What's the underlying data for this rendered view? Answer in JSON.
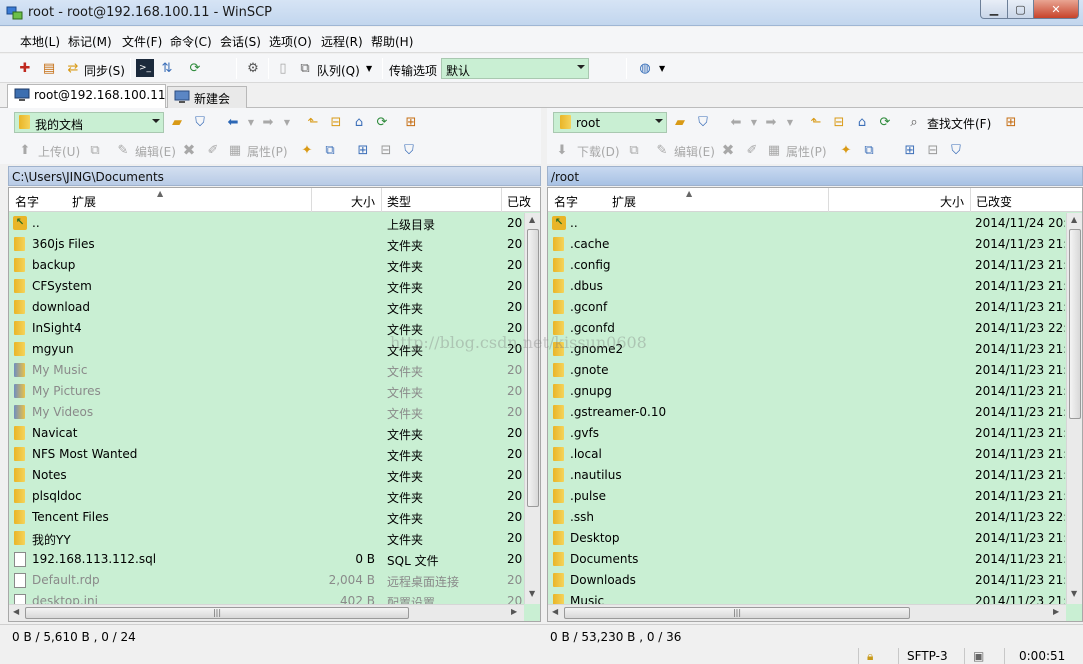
{
  "window": {
    "title": "root - root@192.168.100.11 - WinSCP",
    "min_label": "▁",
    "max_label": "▢",
    "close_label": "✕"
  },
  "menu": [
    "本地(L)",
    "标记(M)",
    "文件(F)",
    "命令(C)",
    "会话(S)",
    "选项(O)",
    "远程(R)",
    "帮助(H)"
  ],
  "toolbar": {
    "sync_label": "同步(S)",
    "queue_label": "队列(Q)",
    "transfer_label": "传输选项",
    "transfer_value": "默认"
  },
  "tabs": {
    "session": "root@192.168.100.11",
    "new_session": "新建会话"
  },
  "left": {
    "location": "我的文档",
    "upload": "上传(U)",
    "edit": "编辑(E)",
    "properties": "属性(P)",
    "path": "C:\\Users\\JING\\Documents",
    "columns": {
      "name": "名字",
      "ext": "扩展",
      "size": "大小",
      "type": "类型",
      "changed": "已改"
    },
    "rows": [
      {
        "name": "..",
        "size": "",
        "type": "上级目录",
        "changed": "20",
        "kind": "up",
        "gray": false
      },
      {
        "name": "360js Files",
        "size": "",
        "type": "文件夹",
        "changed": "20",
        "kind": "folder",
        "gray": false
      },
      {
        "name": "backup",
        "size": "",
        "type": "文件夹",
        "changed": "20",
        "kind": "folder",
        "gray": false
      },
      {
        "name": "CFSystem",
        "size": "",
        "type": "文件夹",
        "changed": "20",
        "kind": "folder",
        "gray": false
      },
      {
        "name": "download",
        "size": "",
        "type": "文件夹",
        "changed": "20",
        "kind": "folder",
        "gray": false
      },
      {
        "name": "InSight4",
        "size": "",
        "type": "文件夹",
        "changed": "20",
        "kind": "folder",
        "gray": false
      },
      {
        "name": "mgyun",
        "size": "",
        "type": "文件夹",
        "changed": "20",
        "kind": "folder",
        "gray": false
      },
      {
        "name": "My Music",
        "size": "",
        "type": "文件夹",
        "changed": "20",
        "kind": "sysfolder",
        "gray": true
      },
      {
        "name": "My Pictures",
        "size": "",
        "type": "文件夹",
        "changed": "20",
        "kind": "sysfolder",
        "gray": true
      },
      {
        "name": "My Videos",
        "size": "",
        "type": "文件夹",
        "changed": "20",
        "kind": "sysfolder",
        "gray": true
      },
      {
        "name": "Navicat",
        "size": "",
        "type": "文件夹",
        "changed": "20",
        "kind": "folder",
        "gray": false
      },
      {
        "name": "NFS Most Wanted",
        "size": "",
        "type": "文件夹",
        "changed": "20",
        "kind": "folder",
        "gray": false
      },
      {
        "name": "Notes",
        "size": "",
        "type": "文件夹",
        "changed": "20",
        "kind": "folder",
        "gray": false
      },
      {
        "name": "plsqldoc",
        "size": "",
        "type": "文件夹",
        "changed": "20",
        "kind": "folder",
        "gray": false
      },
      {
        "name": "Tencent Files",
        "size": "",
        "type": "文件夹",
        "changed": "20",
        "kind": "folder",
        "gray": false
      },
      {
        "name": "我的YY",
        "size": "",
        "type": "文件夹",
        "changed": "20",
        "kind": "folder",
        "gray": false
      },
      {
        "name": "192.168.113.112.sql",
        "size": "0 B",
        "type": "SQL 文件",
        "changed": "20",
        "kind": "file",
        "gray": false
      },
      {
        "name": "Default.rdp",
        "size": "2,004 B",
        "type": "远程桌面连接",
        "changed": "20",
        "kind": "file",
        "gray": true
      },
      {
        "name": "desktop.ini",
        "size": "402 B",
        "type": "配置设置",
        "changed": "20",
        "kind": "file",
        "gray": true
      }
    ],
    "status": "0 B / 5,610 B ,  0 / 24"
  },
  "right": {
    "location": "root",
    "download": "下载(D)",
    "edit": "编辑(E)",
    "properties": "属性(P)",
    "find": "查找文件(F)",
    "path": "/root",
    "columns": {
      "name": "名字",
      "ext": "扩展",
      "size": "大小",
      "changed": "已改变"
    },
    "rows": [
      {
        "name": "..",
        "changed": "2014/11/24 20:",
        "kind": "up"
      },
      {
        "name": ".cache",
        "changed": "2014/11/23 21:",
        "kind": "folder"
      },
      {
        "name": ".config",
        "changed": "2014/11/23 21:",
        "kind": "folder"
      },
      {
        "name": ".dbus",
        "changed": "2014/11/23 21:",
        "kind": "folder"
      },
      {
        "name": ".gconf",
        "changed": "2014/11/23 21:",
        "kind": "folder"
      },
      {
        "name": ".gconfd",
        "changed": "2014/11/23 22:",
        "kind": "folder"
      },
      {
        "name": ".gnome2",
        "changed": "2014/11/23 21:",
        "kind": "folder"
      },
      {
        "name": ".gnote",
        "changed": "2014/11/23 21:",
        "kind": "folder"
      },
      {
        "name": ".gnupg",
        "changed": "2014/11/23 21:",
        "kind": "folder"
      },
      {
        "name": ".gstreamer-0.10",
        "changed": "2014/11/23 21:",
        "kind": "folder"
      },
      {
        "name": ".gvfs",
        "changed": "2014/11/23 21:",
        "kind": "folder"
      },
      {
        "name": ".local",
        "changed": "2014/11/23 21:",
        "kind": "folder"
      },
      {
        "name": ".nautilus",
        "changed": "2014/11/23 21:",
        "kind": "folder"
      },
      {
        "name": ".pulse",
        "changed": "2014/11/23 21:",
        "kind": "folder"
      },
      {
        "name": ".ssh",
        "changed": "2014/11/23 22:",
        "kind": "folder"
      },
      {
        "name": "Desktop",
        "changed": "2014/11/23 21:",
        "kind": "folder"
      },
      {
        "name": "Documents",
        "changed": "2014/11/23 21:",
        "kind": "folder"
      },
      {
        "name": "Downloads",
        "changed": "2014/11/23 21:",
        "kind": "folder"
      },
      {
        "name": "Music",
        "changed": "2014/11/23 21:",
        "kind": "folder"
      }
    ],
    "status": "0 B / 53,230 B ,  0 / 36"
  },
  "statusbar": {
    "protocol": "SFTP-3",
    "time": "0:00:51"
  },
  "watermark": "http://blog.csdn.net/kissun0608",
  "icons": {
    "lock": "lock-icon",
    "computer": "computer-icon",
    "folder": "folder-icon"
  }
}
